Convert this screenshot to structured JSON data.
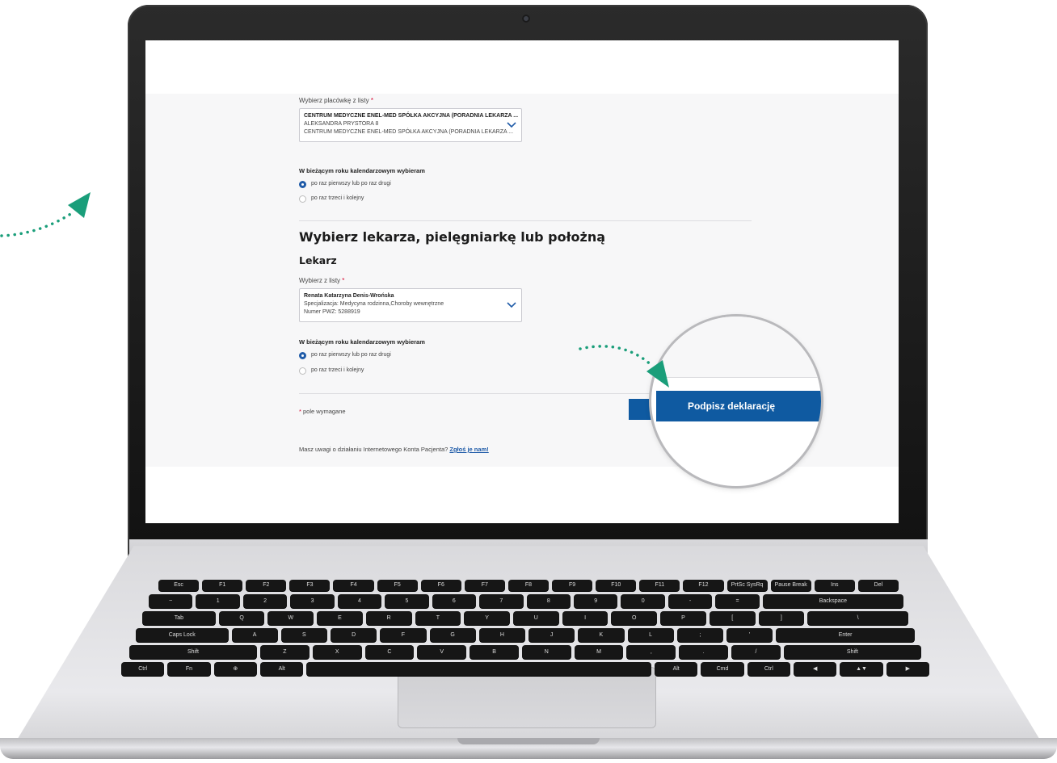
{
  "form": {
    "facility_label": "Wybierz placówkę z listy",
    "required_mark": "*",
    "facility_select": {
      "line1": "CENTRUM MEDYCZNE ENEL-MED SPÓŁKA AKCYJNA (PORADNIA LEKARZA ...",
      "line2": "ALEKSANDRA PRYSTORA 8",
      "line3": "CENTRUM MEDYCZNE ENEL-MED SPÓŁKA AKCYJNA (PORADNIA LEKARZA ..."
    },
    "choice_group_1": {
      "title": "W bieżącym roku kalendarzowym wybieram",
      "options": [
        "po raz pierwszy lub po raz drugi",
        "po raz trzeci i kolejny"
      ],
      "selected": 0
    },
    "section_title": "Wybierz lekarza, pielęgniarkę lub położną",
    "subsection_title": "Lekarz",
    "doctor_label": "Wybierz z listy",
    "doctor_select": {
      "line1": "Renata Katarzyna Denis-Wrońska",
      "line2": "Specjalizacja: Medycyna rodzinna,Choroby wewnętrzne",
      "line3": "Numer PWZ: 5288919"
    },
    "choice_group_2": {
      "title": "W bieżącym roku kalendarzowym wybieram",
      "options": [
        "po raz pierwszy lub po raz drugi",
        "po raz trzeci i kolejny"
      ],
      "selected": 0
    },
    "required_note": "pole wymagane",
    "sign_button": "Podpisz deklarację",
    "feedback_text": "Masz uwagi o działaniu Internetowego Konta Pacjenta?",
    "feedback_link": "Zgłoś je nam!"
  },
  "keyboard": {
    "row_fn": [
      "Esc",
      "F1",
      "F2",
      "F3",
      "F4",
      "F5",
      "F6",
      "F7",
      "F8",
      "F9",
      "F10",
      "F11",
      "F12",
      "PrtSc SysRq",
      "Pause Break",
      "Ins",
      "Del"
    ],
    "row_num": [
      "~",
      "1",
      "2",
      "3",
      "4",
      "5",
      "6",
      "7",
      "8",
      "9",
      "0",
      "-",
      "=",
      "Backspace"
    ],
    "row_top": [
      "Tab",
      "Q",
      "W",
      "E",
      "R",
      "T",
      "Y",
      "U",
      "I",
      "O",
      "P",
      "[",
      "]",
      "\\"
    ],
    "row_home": [
      "Caps Lock",
      "A",
      "S",
      "D",
      "F",
      "G",
      "H",
      "J",
      "K",
      "L",
      ";",
      "'",
      "Enter"
    ],
    "row_shift": [
      "Shift",
      "Z",
      "X",
      "C",
      "V",
      "B",
      "N",
      "M",
      ",",
      ".",
      "/",
      "Shift"
    ],
    "row_bottom": [
      "Ctrl",
      "Fn",
      "⊕",
      "Alt",
      "",
      "Alt",
      "Cmd",
      "Ctrl",
      "◀",
      "▲▼",
      "▶"
    ]
  },
  "colors": {
    "primary": "#0f5aa1",
    "accent_arrow": "#1a9e7a",
    "required": "#d6002a"
  }
}
